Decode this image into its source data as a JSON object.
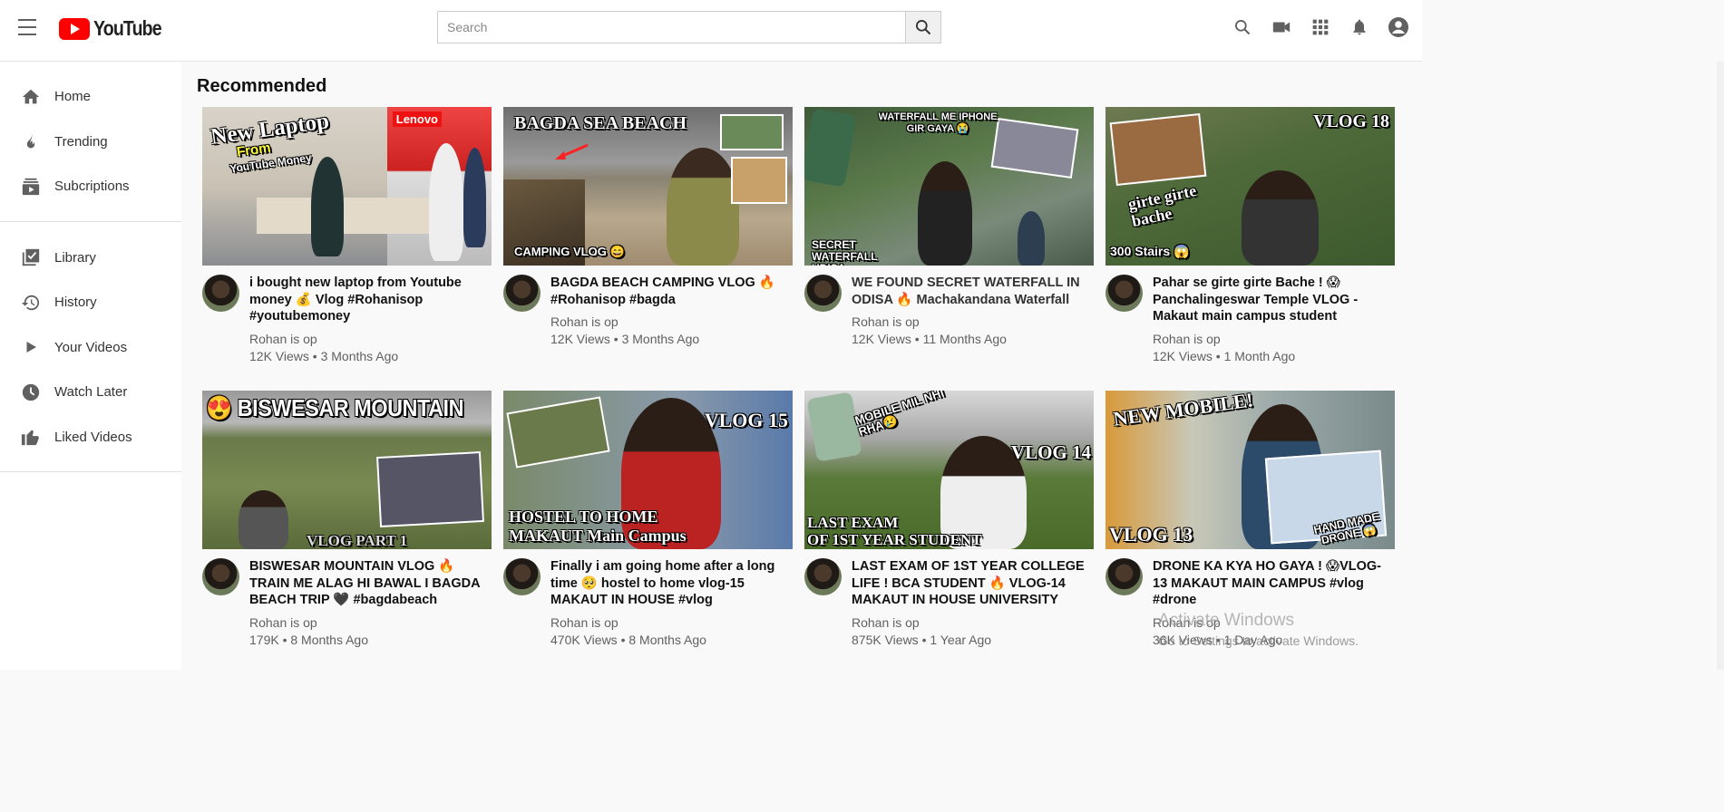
{
  "brand": {
    "name": "YouTube"
  },
  "search": {
    "placeholder": "Search"
  },
  "sidebar": {
    "primary": [
      {
        "label": "Home",
        "icon": "home-icon"
      },
      {
        "label": "Trending",
        "icon": "flame-icon"
      },
      {
        "label": "Subcriptions",
        "icon": "subscriptions-icon"
      }
    ],
    "secondary": [
      {
        "label": "Library",
        "icon": "library-icon"
      },
      {
        "label": "History",
        "icon": "history-icon"
      },
      {
        "label": "Your Videos",
        "icon": "play-icon"
      },
      {
        "label": "Watch Later",
        "icon": "clock-icon"
      },
      {
        "label": "Liked Videos",
        "icon": "thumbs-up-icon"
      }
    ]
  },
  "header_icons": [
    "search-icon",
    "video-camera-icon",
    "apps-grid-icon",
    "bell-icon",
    "account-icon"
  ],
  "section": {
    "title": "Recommended"
  },
  "videos": [
    {
      "title": "i bought new laptop from Youtube money 💰 Vlog #Rohanisop #youtubemoney",
      "channel": "Rohan is op",
      "stats": "12K Views • 3 Months Ago",
      "thumb_text": "New Laptop",
      "thumb_text2": "From",
      "thumb_text3": "YouTube Money",
      "thumb_text4": "Lenovo"
    },
    {
      "title": "BAGDA BEACH CAMPING VLOG 🔥 #Rohanisop #bagda",
      "channel": "Rohan is op",
      "stats": "12K Views • 3 Months Ago",
      "thumb_text": "BAGDA SEA BEACH",
      "thumb_text2": "CAMPING VLOG 😄"
    },
    {
      "title": "WE FOUND SECRET WATERFALL IN ODISA 🔥 Machakandana Waterfall",
      "channel": "Rohan is op",
      "stats": "12K Views • 11 Months Ago",
      "thumb_text": "WATERFALL ME IPHONE GIR GAYA 😭",
      "thumb_text2": "SECRET WATERFALL UDISA"
    },
    {
      "title": "Pahar se girte girte Bache ! 😱 Panchalingeswar Temple VLOG - Makaut main campus student",
      "channel": "Rohan is op",
      "stats": "12K Views • 1 Month Ago",
      "thumb_text": "VLOG 18",
      "thumb_text2": "girte girte bache",
      "thumb_text3": "300 Stairs 😱"
    },
    {
      "title": "BISWESAR MOUNTAIN VLOG 🔥 TRAIN ME ALAG HI BAWAL I BAGDA BEACH TRIP 🖤 #bagdabeach",
      "channel": "Rohan is op",
      "stats": "179K • 8 Months Ago",
      "thumb_text": "😍 BISWESAR  MOUNTAIN",
      "thumb_text2": "VLOG PART 1"
    },
    {
      "title": "Finally i am going home after a long time 🥺 hostel to home vlog-15 MAKAUT IN HOUSE #vlog",
      "channel": "Rohan is op",
      "stats": "470K Views • 8 Months Ago",
      "thumb_text": "VLOG 15",
      "thumb_text2": "HOSTEL TO HOME",
      "thumb_text3": "MAKAUT Main Campus"
    },
    {
      "title": "LAST EXAM OF 1ST YEAR COLLEGE LIFE ! BCA STUDENT 🔥 VLOG-14 MAKAUT IN HOUSE UNIVERSITY #VLOG",
      "channel": "Rohan is op",
      "stats": "875K Views • 1 Year Ago",
      "thumb_text": "MOBILE MIL NHI RHA😢",
      "thumb_text2": "VLOG 14",
      "thumb_text3": "LAST EXAM",
      "thumb_text4": "OF 1ST YEAR STUDENT"
    },
    {
      "title": "DRONE KA KYA HO GAYA ! 😱VLOG-13 MAKAUT MAIN CAMPUS #vlog #drone",
      "channel": "Rohan is op",
      "stats": "36K Views • 1 Day Ago",
      "thumb_text": "NEW MOBILE!",
      "thumb_text2": "VLOG 13",
      "thumb_text3": "HAND MADE DRONE 😱"
    }
  ],
  "watermark": {
    "line1": "Activate Windows",
    "line2": "Go to Settings to activate Windows."
  },
  "colors": {
    "brand_red": "#ff0000",
    "icon_gray": "#606060"
  }
}
